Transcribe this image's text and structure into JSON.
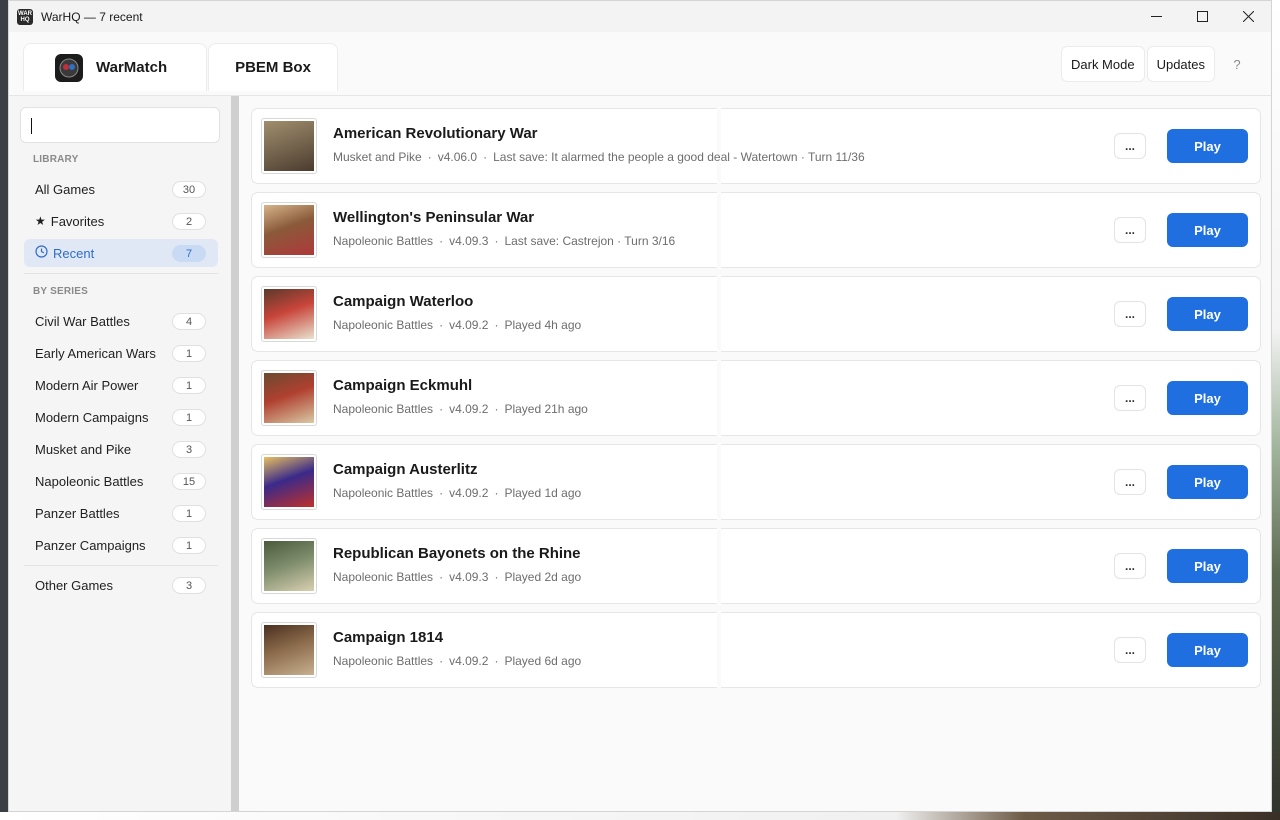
{
  "window": {
    "title": "WarHQ — 7 recent",
    "app_icon_text": "WAR HQ",
    "controls": {
      "minimize": "—",
      "maximize": "☐",
      "close": "✕"
    }
  },
  "header": {
    "tabs": [
      {
        "label": "WarMatch",
        "icon": "warmatch-logo-icon"
      },
      {
        "label": "PBEM Box"
      }
    ],
    "dark_mode_label": "Dark Mode",
    "updates_label": "Updates",
    "help_label": "?"
  },
  "sidebar": {
    "search_value": "",
    "library_heading": "LIBRARY",
    "library": [
      {
        "label": "All Games",
        "count": "30"
      },
      {
        "label": "Favorites",
        "count": "2",
        "icon": "★"
      },
      {
        "label": "Recent",
        "count": "7",
        "icon": "🕒",
        "active": true
      }
    ],
    "series_heading": "BY SERIES",
    "series": [
      {
        "label": "Civil War Battles",
        "count": "4"
      },
      {
        "label": "Early American Wars",
        "count": "1"
      },
      {
        "label": "Modern Air Power",
        "count": "1"
      },
      {
        "label": "Modern Campaigns",
        "count": "1"
      },
      {
        "label": "Musket and Pike",
        "count": "3"
      },
      {
        "label": "Napoleonic Battles",
        "count": "15"
      },
      {
        "label": "Panzer Battles",
        "count": "1"
      },
      {
        "label": "Panzer Campaigns",
        "count": "1"
      }
    ],
    "other": {
      "label": "Other Games",
      "count": "3"
    }
  },
  "games": [
    {
      "title": "American Revolutionary War",
      "series": "Musket and Pike",
      "version": "v4.06.0",
      "status": "Last save: It alarmed the people a good deal - Watertown · Turn 11/36",
      "more": "...",
      "play": "Play",
      "cover_colors": [
        "#7b6a52",
        "#4a3b2e",
        "#a08e6d"
      ]
    },
    {
      "title": "Wellington's Peninsular War",
      "series": "Napoleonic Battles",
      "version": "v4.09.3",
      "status": "Last save: Castrejon · Turn 3/16",
      "more": "...",
      "play": "Play",
      "cover_colors": [
        "#8a5a3a",
        "#b0383a",
        "#d6b48a"
      ]
    },
    {
      "title": "Campaign Waterloo",
      "series": "Napoleonic Battles",
      "version": "v4.09.2",
      "status": "Played 4h ago",
      "more": "...",
      "play": "Play",
      "cover_colors": [
        "#c8443a",
        "#e9e2cf",
        "#5a3a2a"
      ]
    },
    {
      "title": "Campaign Eckmuhl",
      "series": "Napoleonic Battles",
      "version": "v4.09.2",
      "status": "Played 21h ago",
      "more": "...",
      "play": "Play",
      "cover_colors": [
        "#b04030",
        "#d9c9a5",
        "#6a4a30"
      ]
    },
    {
      "title": "Campaign Austerlitz",
      "series": "Napoleonic Battles",
      "version": "v4.09.2",
      "status": "Played 1d ago",
      "more": "...",
      "play": "Play",
      "cover_colors": [
        "#3a2a8a",
        "#c0302a",
        "#e8c060"
      ]
    },
    {
      "title": "Republican Bayonets on the Rhine",
      "series": "Napoleonic Battles",
      "version": "v4.09.3",
      "status": "Played 2d ago",
      "more": "...",
      "play": "Play",
      "cover_colors": [
        "#7a8a6a",
        "#d8d0b0",
        "#4a5a3a"
      ]
    },
    {
      "title": "Campaign 1814",
      "series": "Napoleonic Battles",
      "version": "v4.09.2",
      "status": "Played 6d ago",
      "more": "...",
      "play": "Play",
      "cover_colors": [
        "#8a6a4a",
        "#c8b090",
        "#4a3020"
      ]
    }
  ]
}
